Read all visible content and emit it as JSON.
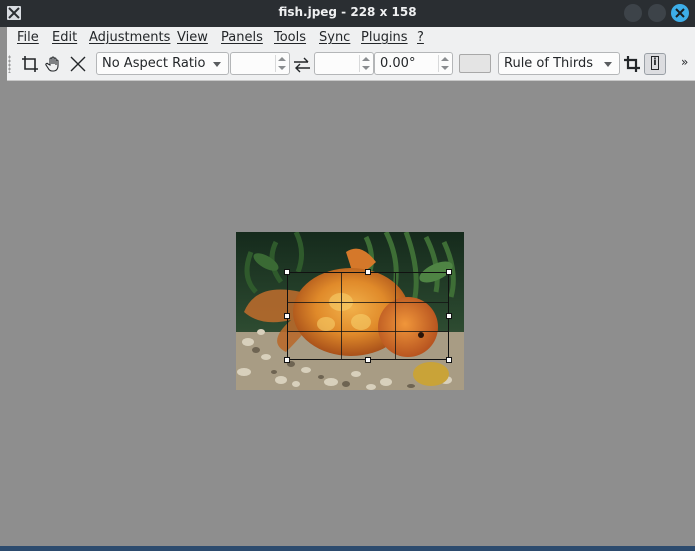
{
  "window": {
    "title": "fish.jpeg  - 228 x 158",
    "accent": "#3daee9"
  },
  "menu": {
    "items": [
      "File",
      "Edit",
      "Adjustments",
      "View",
      "Panels",
      "Tools",
      "Sync",
      "Plugins",
      "?"
    ]
  },
  "toolbar": {
    "icons": [
      "crop-icon",
      "hand-icon",
      "close-x-icon",
      "swap-arrows-icon",
      "crop-apply-icon",
      "info-icon",
      "overflow-chevron-icon"
    ],
    "aspect_ratio": "No Aspect Ratio",
    "width_value": "",
    "height_value": "",
    "rotation": "0.00°",
    "guide": "Rule of Thirds",
    "overflow_label": "»"
  },
  "image": {
    "description_icon": "goldfish-photo",
    "colors": {
      "water": "#1e3a28",
      "fish": "#d97a22",
      "gravel": "#b8ab90"
    }
  }
}
